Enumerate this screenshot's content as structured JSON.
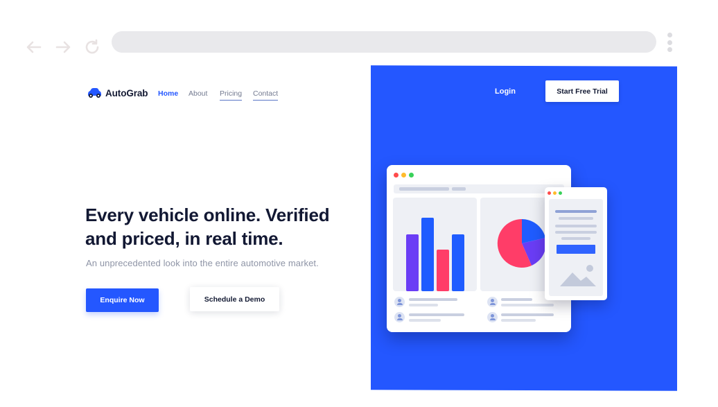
{
  "browser": {
    "back_icon": "arrow-left-icon",
    "forward_icon": "arrow-right-icon",
    "reload_icon": "reload-icon",
    "menu_icon": "kebab-menu-icon"
  },
  "brand": {
    "name": "AutoGrab",
    "logo_icon": "car-icon"
  },
  "nav": {
    "home": "Home",
    "about": "About",
    "pricing": "Pricing",
    "contact": "Contact",
    "login": "Login",
    "trial": "Start Free Trial"
  },
  "hero": {
    "title": "Every vehicle online. Verified and priced, in real time.",
    "subtitle": "An unprecedented look into the entire automotive market.",
    "cta_primary": "Enquire Now",
    "cta_secondary": "Schedule a Demo"
  },
  "colors": {
    "accent": "#2457ff",
    "bar_purple": "#6a3df5",
    "bar_blue": "#1f5cff",
    "bar_pink": "#ff3d68"
  }
}
